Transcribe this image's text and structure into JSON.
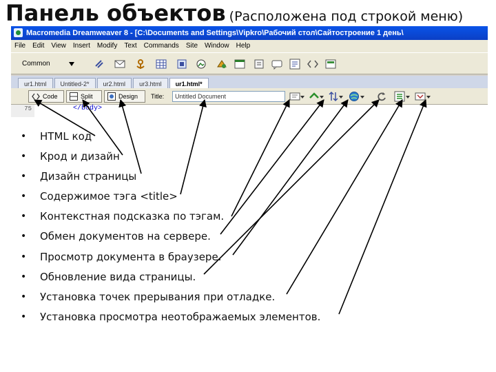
{
  "slide": {
    "title": "Панель объектов",
    "subtitle": "(Расположена под строкой меню)"
  },
  "window": {
    "title": "Macromedia Dreamweaver 8 - [C:\\Documents and Settings\\Vipkro\\Рабочий стол\\Сайтостроение 1 день\\"
  },
  "menu": [
    "File",
    "Edit",
    "View",
    "Insert",
    "Modify",
    "Text",
    "Commands",
    "Site",
    "Window",
    "Help"
  ],
  "insert_bar": {
    "category": "Common"
  },
  "doc_tabs": [
    "ur1.html",
    "Untitled-2*",
    "ur2.html",
    "ur3.html",
    "ur1.html*"
  ],
  "doc_toolbar": {
    "code_label": "Code",
    "split_label": "Split",
    "design_label": "Design",
    "title_label": "Title:",
    "title_value": "Untitled Document"
  },
  "code_view": {
    "line_number": "75",
    "code_text": "</body>"
  },
  "bullets": [
    "HTML код",
    "Крод и дизайн",
    "Дизайн страницы",
    "Содержимое тэга <title>",
    "Контекстная подсказка по тэгам.",
    "Обмен документов на сервере.",
    "Просмотр документа в браузере.",
    "Обновление вида страницы.",
    "Установка точек прерывания при отладке.",
    "Установка просмотра неотображаемых элементов."
  ],
  "colors": {
    "titlebar": "#0a54e8",
    "toolbar_bg": "#ece9d8",
    "arrow": "#000000"
  }
}
